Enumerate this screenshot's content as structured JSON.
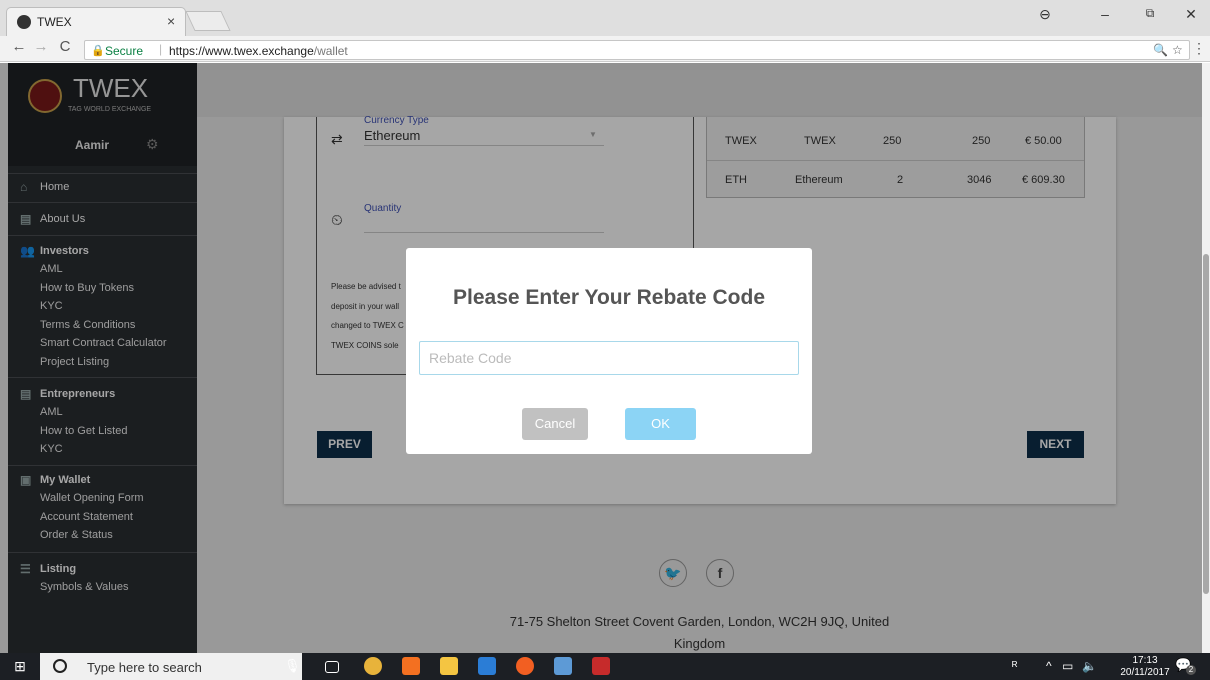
{
  "browser": {
    "tab_title": "TWEX",
    "tab_close": "×",
    "secure_label": "Secure",
    "url_base": "https://www.twex.exchange",
    "url_path": "/wallet",
    "window": {
      "minimize": "–",
      "maximize": "⧉",
      "close": "✕",
      "profile": "⊖"
    }
  },
  "sidebar": {
    "logo_title": "TWEX",
    "logo_subtitle": "TAG WORLD EXCHANGE",
    "user_name": "Aamir",
    "home": "Home",
    "about": "About Us",
    "investors": {
      "label": "Investors",
      "items": [
        "AML",
        "How to Buy Tokens",
        "KYC",
        "Terms & Conditions",
        "Smart Contract Calculator",
        "Project Listing"
      ]
    },
    "entrepreneurs": {
      "label": "Entrepreneurs",
      "items": [
        "AML",
        "How to Get Listed",
        "KYC"
      ]
    },
    "wallet": {
      "label": "My Wallet",
      "items": [
        "Wallet Opening Form",
        "Account Statement",
        "Order & Status"
      ]
    },
    "listing": {
      "label": "Listing",
      "items": [
        "Symbols & Values"
      ]
    }
  },
  "form": {
    "currency_label": "Currency Type",
    "currency_value": "Ethereum",
    "quantity_label": "Quantity",
    "notice_lines": [
      "Please be advised t",
      "deposit in your wall",
      "changed to TWEX C",
      "TWEX COINS sole"
    ],
    "prev": "PREV",
    "next": "NEXT"
  },
  "holdings": {
    "rows": [
      [
        "TWEX",
        "TWEX",
        "250",
        "250",
        "€ 50.00"
      ],
      [
        "ETH",
        "Ethereum",
        "2",
        "3046",
        "€ 609.30"
      ]
    ]
  },
  "footer": {
    "address_line1": "71-75 Shelton Street Covent Garden, London, WC2H 9JQ, United",
    "address_line2": "Kingdom",
    "twitter_glyph": "🐦",
    "facebook_glyph": "f"
  },
  "modal": {
    "title": "Please Enter Your Rebate Code",
    "placeholder": "Rebate Code",
    "cancel": "Cancel",
    "ok": "OK"
  },
  "taskbar": {
    "search_placeholder": "Type here to search",
    "time": "17:13",
    "date": "20/11/2017",
    "notification_count": "2"
  }
}
